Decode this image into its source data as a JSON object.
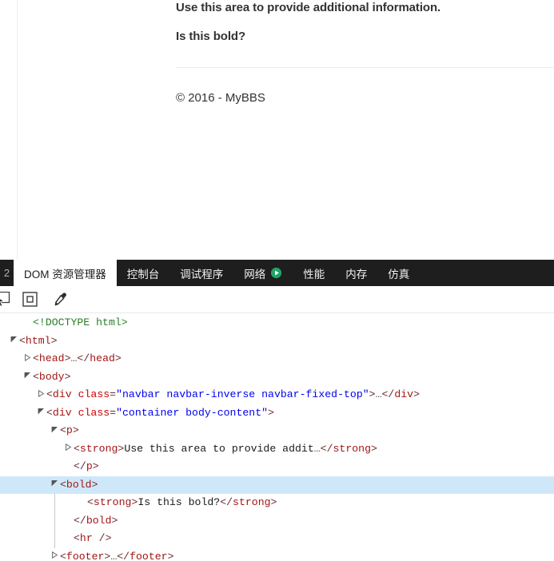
{
  "page": {
    "paragraph_additional_info": "Use this area to provide additional information.",
    "paragraph_is_this_bold": "Is this bold?",
    "footer": "© 2016 - MyBBS"
  },
  "devtools": {
    "overflow_indicator": "2",
    "tabs": [
      {
        "label": "DOM 资源管理器",
        "active": true,
        "icon": null
      },
      {
        "label": "控制台",
        "active": false,
        "icon": null
      },
      {
        "label": "调试程序",
        "active": false,
        "icon": null
      },
      {
        "label": "网络",
        "active": false,
        "icon": "play-circle-icon"
      },
      {
        "label": "性能",
        "active": false,
        "icon": null
      },
      {
        "label": "内存",
        "active": false,
        "icon": null
      },
      {
        "label": "仿真",
        "active": false,
        "icon": null
      }
    ],
    "toolbar": [
      {
        "name": "inspect-element-icon"
      },
      {
        "name": "select-box-icon"
      },
      {
        "name": "color-picker-icon"
      }
    ],
    "colors": {
      "tabstrip_background": "#1e1e1e",
      "active_tab_background": "#ffffff",
      "network_play_icon": "#21a366",
      "selected_row_background": "#cfe8f9",
      "tag_color": "#a31515",
      "attribute_name_color": "#cc0000",
      "attribute_value_color": "#0000ee",
      "doctype_color": "#267f26"
    },
    "dom_rows": [
      {
        "indent": 1,
        "twisty": "none",
        "selected": false,
        "tokens": [
          {
            "t": "doctype",
            "v": "<!DOCTYPE html>"
          }
        ]
      },
      {
        "indent": 0,
        "twisty": "expanded",
        "selected": false,
        "tokens": [
          {
            "t": "punct",
            "v": "<"
          },
          {
            "t": "tag",
            "v": "html"
          },
          {
            "t": "punct",
            "v": ">"
          }
        ]
      },
      {
        "indent": 1,
        "twisty": "collapsed",
        "selected": false,
        "tokens": [
          {
            "t": "punct",
            "v": "<"
          },
          {
            "t": "tag",
            "v": "head"
          },
          {
            "t": "punct",
            "v": ">"
          },
          {
            "t": "ellipsis",
            "v": "…"
          },
          {
            "t": "punct",
            "v": "</"
          },
          {
            "t": "tag",
            "v": "head"
          },
          {
            "t": "punct",
            "v": ">"
          }
        ]
      },
      {
        "indent": 1,
        "twisty": "expanded",
        "selected": false,
        "tokens": [
          {
            "t": "punct",
            "v": "<"
          },
          {
            "t": "tag",
            "v": "body"
          },
          {
            "t": "punct",
            "v": ">"
          }
        ]
      },
      {
        "indent": 2,
        "twisty": "collapsed",
        "selected": false,
        "tokens": [
          {
            "t": "punct",
            "v": "<"
          },
          {
            "t": "tag",
            "v": "div"
          },
          {
            "t": "content",
            "v": " "
          },
          {
            "t": "attr",
            "v": "class"
          },
          {
            "t": "eq",
            "v": "="
          },
          {
            "t": "val",
            "v": "\"navbar navbar-inverse navbar-fixed-top\""
          },
          {
            "t": "punct",
            "v": ">"
          },
          {
            "t": "ellipsis",
            "v": "…"
          },
          {
            "t": "punct",
            "v": "</"
          },
          {
            "t": "tag",
            "v": "div"
          },
          {
            "t": "punct",
            "v": ">"
          }
        ]
      },
      {
        "indent": 2,
        "twisty": "expanded",
        "selected": false,
        "tokens": [
          {
            "t": "punct",
            "v": "<"
          },
          {
            "t": "tag",
            "v": "div"
          },
          {
            "t": "content",
            "v": " "
          },
          {
            "t": "attr",
            "v": "class"
          },
          {
            "t": "eq",
            "v": "="
          },
          {
            "t": "val",
            "v": "\"container body-content\""
          },
          {
            "t": "punct",
            "v": ">"
          }
        ]
      },
      {
        "indent": 3,
        "twisty": "expanded",
        "selected": false,
        "tokens": [
          {
            "t": "punct",
            "v": "<"
          },
          {
            "t": "tag",
            "v": "p"
          },
          {
            "t": "punct",
            "v": ">"
          }
        ]
      },
      {
        "indent": 4,
        "twisty": "collapsed",
        "selected": false,
        "tokens": [
          {
            "t": "punct",
            "v": "<"
          },
          {
            "t": "tag",
            "v": "strong"
          },
          {
            "t": "punct",
            "v": ">"
          },
          {
            "t": "content",
            "v": "Use this area to provide addit"
          },
          {
            "t": "ellipsis",
            "v": "…"
          },
          {
            "t": "punct",
            "v": "</"
          },
          {
            "t": "tag",
            "v": "strong"
          },
          {
            "t": "punct",
            "v": ">"
          }
        ]
      },
      {
        "indent": 4,
        "twisty": "none",
        "selected": false,
        "tokens": [
          {
            "t": "punct",
            "v": "</"
          },
          {
            "t": "tag",
            "v": "p"
          },
          {
            "t": "punct",
            "v": ">"
          }
        ]
      },
      {
        "indent": 3,
        "twisty": "expanded",
        "selected": true,
        "tokens": [
          {
            "t": "punct",
            "v": "<"
          },
          {
            "t": "tag",
            "v": "bold"
          },
          {
            "t": "punct",
            "v": ">"
          }
        ]
      },
      {
        "indent": 5,
        "twisty": "none",
        "selected": false,
        "tokens": [
          {
            "t": "punct",
            "v": "<"
          },
          {
            "t": "tag",
            "v": "strong"
          },
          {
            "t": "punct",
            "v": ">"
          },
          {
            "t": "content",
            "v": "Is this bold?"
          },
          {
            "t": "punct",
            "v": "</"
          },
          {
            "t": "tag",
            "v": "strong"
          },
          {
            "t": "punct",
            "v": ">"
          }
        ]
      },
      {
        "indent": 4,
        "twisty": "none",
        "selected": false,
        "tokens": [
          {
            "t": "punct",
            "v": "</"
          },
          {
            "t": "tag",
            "v": "bold"
          },
          {
            "t": "punct",
            "v": ">"
          }
        ]
      },
      {
        "indent": 4,
        "twisty": "none",
        "selected": false,
        "tokens": [
          {
            "t": "punct",
            "v": "<"
          },
          {
            "t": "tag",
            "v": "hr"
          },
          {
            "t": "punct",
            "v": " />"
          }
        ]
      },
      {
        "indent": 3,
        "twisty": "collapsed",
        "selected": false,
        "tokens": [
          {
            "t": "punct",
            "v": "<"
          },
          {
            "t": "tag",
            "v": "footer"
          },
          {
            "t": "punct",
            "v": ">"
          },
          {
            "t": "ellipsis",
            "v": "…"
          },
          {
            "t": "punct",
            "v": "</"
          },
          {
            "t": "tag",
            "v": "footer"
          },
          {
            "t": "punct",
            "v": ">"
          }
        ]
      }
    ]
  }
}
